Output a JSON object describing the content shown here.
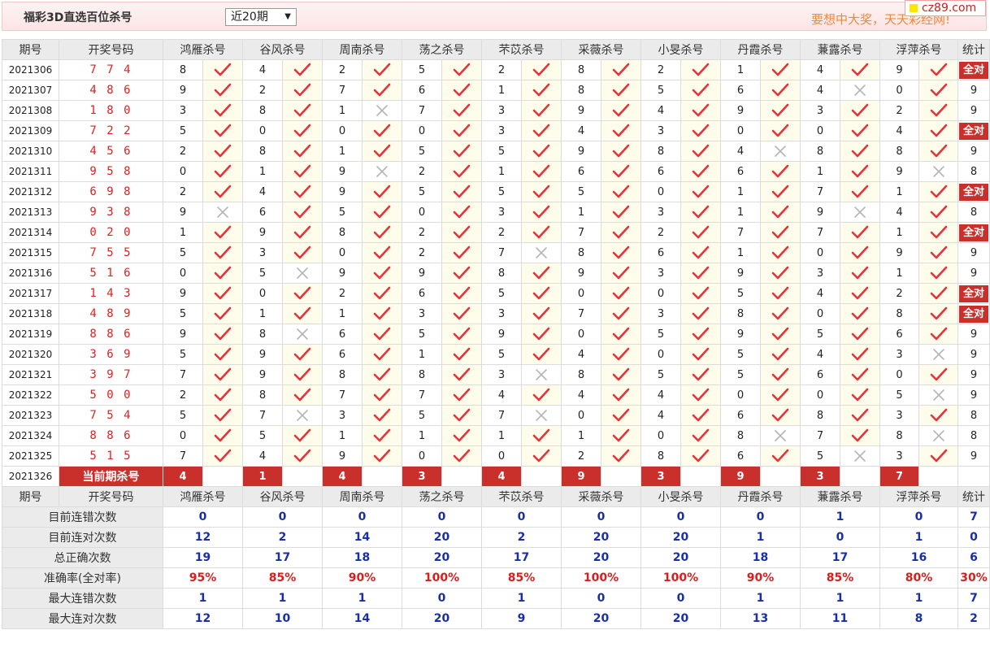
{
  "header": {
    "title": "福彩3D直选百位杀号",
    "period_select": "近20期",
    "slogan": "要想中大奖，天天彩经网!",
    "site_logo": "cz89.com"
  },
  "table": {
    "columns": {
      "period": "期号",
      "numbers": "开奖号码",
      "experts": [
        "鸿雁杀号",
        "谷风杀号",
        "周南杀号",
        "荡之杀号",
        "芣苡杀号",
        "采薇杀号",
        "小旻杀号",
        "丹霞杀号",
        "蒹露杀号",
        "浮萍杀号"
      ],
      "stat": "统计"
    },
    "rows": [
      {
        "period": "2021306",
        "numbers": "7 7 4",
        "kills": [
          "8",
          "4",
          "2",
          "5",
          "2",
          "8",
          "2",
          "1",
          "4",
          "9"
        ],
        "hits": [
          true,
          true,
          true,
          true,
          true,
          true,
          true,
          true,
          true,
          true
        ],
        "stat": "全对"
      },
      {
        "period": "2021307",
        "numbers": "4 8 6",
        "kills": [
          "9",
          "2",
          "7",
          "6",
          "1",
          "8",
          "5",
          "6",
          "4",
          "0"
        ],
        "hits": [
          true,
          true,
          true,
          true,
          true,
          true,
          true,
          true,
          false,
          true
        ],
        "stat": "9"
      },
      {
        "period": "2021308",
        "numbers": "1 8 0",
        "kills": [
          "3",
          "8",
          "1",
          "7",
          "3",
          "9",
          "4",
          "9",
          "3",
          "2"
        ],
        "hits": [
          true,
          true,
          false,
          true,
          true,
          true,
          true,
          true,
          true,
          true
        ],
        "stat": "9"
      },
      {
        "period": "2021309",
        "numbers": "7 2 2",
        "kills": [
          "5",
          "0",
          "0",
          "0",
          "3",
          "4",
          "3",
          "0",
          "0",
          "4"
        ],
        "hits": [
          true,
          true,
          true,
          true,
          true,
          true,
          true,
          true,
          true,
          true
        ],
        "stat": "全对"
      },
      {
        "period": "2021310",
        "numbers": "4 5 6",
        "kills": [
          "2",
          "8",
          "1",
          "5",
          "5",
          "9",
          "8",
          "4",
          "8",
          "8"
        ],
        "hits": [
          true,
          true,
          true,
          true,
          true,
          true,
          true,
          false,
          true,
          true
        ],
        "stat": "9"
      },
      {
        "period": "2021311",
        "numbers": "9 5 8",
        "kills": [
          "0",
          "1",
          "9",
          "2",
          "1",
          "6",
          "6",
          "6",
          "1",
          "9"
        ],
        "hits": [
          true,
          true,
          false,
          true,
          true,
          true,
          true,
          true,
          true,
          false
        ],
        "stat": "8"
      },
      {
        "period": "2021312",
        "numbers": "6 9 8",
        "kills": [
          "2",
          "4",
          "9",
          "5",
          "5",
          "5",
          "0",
          "1",
          "7",
          "1"
        ],
        "hits": [
          true,
          true,
          true,
          true,
          true,
          true,
          true,
          true,
          true,
          true
        ],
        "stat": "全对"
      },
      {
        "period": "2021313",
        "numbers": "9 3 8",
        "kills": [
          "9",
          "6",
          "5",
          "0",
          "3",
          "1",
          "3",
          "1",
          "9",
          "4"
        ],
        "hits": [
          false,
          true,
          true,
          true,
          true,
          true,
          true,
          true,
          false,
          true
        ],
        "stat": "8"
      },
      {
        "period": "2021314",
        "numbers": "0 2 0",
        "kills": [
          "1",
          "9",
          "8",
          "2",
          "2",
          "7",
          "2",
          "7",
          "7",
          "1"
        ],
        "hits": [
          true,
          true,
          true,
          true,
          true,
          true,
          true,
          true,
          true,
          true
        ],
        "stat": "全对"
      },
      {
        "period": "2021315",
        "numbers": "7 5 5",
        "kills": [
          "5",
          "3",
          "0",
          "2",
          "7",
          "8",
          "6",
          "1",
          "0",
          "9"
        ],
        "hits": [
          true,
          true,
          true,
          true,
          false,
          true,
          true,
          true,
          true,
          true
        ],
        "stat": "9"
      },
      {
        "period": "2021316",
        "numbers": "5 1 6",
        "kills": [
          "0",
          "5",
          "9",
          "9",
          "8",
          "9",
          "3",
          "9",
          "3",
          "1"
        ],
        "hits": [
          true,
          false,
          true,
          true,
          true,
          true,
          true,
          true,
          true,
          true
        ],
        "stat": "9"
      },
      {
        "period": "2021317",
        "numbers": "1 4 3",
        "kills": [
          "9",
          "0",
          "2",
          "6",
          "5",
          "0",
          "0",
          "5",
          "4",
          "2"
        ],
        "hits": [
          true,
          true,
          true,
          true,
          true,
          true,
          true,
          true,
          true,
          true
        ],
        "stat": "全对"
      },
      {
        "period": "2021318",
        "numbers": "4 8 9",
        "kills": [
          "5",
          "1",
          "1",
          "3",
          "3",
          "7",
          "3",
          "8",
          "0",
          "8"
        ],
        "hits": [
          true,
          true,
          true,
          true,
          true,
          true,
          true,
          true,
          true,
          true
        ],
        "stat": "全对"
      },
      {
        "period": "2021319",
        "numbers": "8 8 6",
        "kills": [
          "9",
          "8",
          "6",
          "5",
          "9",
          "0",
          "5",
          "9",
          "5",
          "6"
        ],
        "hits": [
          true,
          false,
          true,
          true,
          true,
          true,
          true,
          true,
          true,
          true
        ],
        "stat": "9"
      },
      {
        "period": "2021320",
        "numbers": "3 6 9",
        "kills": [
          "5",
          "9",
          "6",
          "1",
          "5",
          "4",
          "0",
          "5",
          "4",
          "3"
        ],
        "hits": [
          true,
          true,
          true,
          true,
          true,
          true,
          true,
          true,
          true,
          false
        ],
        "stat": "9"
      },
      {
        "period": "2021321",
        "numbers": "3 9 7",
        "kills": [
          "7",
          "9",
          "8",
          "8",
          "3",
          "8",
          "5",
          "5",
          "6",
          "0"
        ],
        "hits": [
          true,
          true,
          true,
          true,
          false,
          true,
          true,
          true,
          true,
          true
        ],
        "stat": "9"
      },
      {
        "period": "2021322",
        "numbers": "5 0 0",
        "kills": [
          "2",
          "8",
          "7",
          "7",
          "4",
          "4",
          "4",
          "0",
          "0",
          "5"
        ],
        "hits": [
          true,
          true,
          true,
          true,
          true,
          true,
          true,
          true,
          true,
          false
        ],
        "stat": "9"
      },
      {
        "period": "2021323",
        "numbers": "7 5 4",
        "kills": [
          "5",
          "7",
          "3",
          "5",
          "7",
          "0",
          "4",
          "6",
          "8",
          "3"
        ],
        "hits": [
          true,
          false,
          true,
          true,
          false,
          true,
          true,
          true,
          true,
          true
        ],
        "stat": "8"
      },
      {
        "period": "2021324",
        "numbers": "8 8 6",
        "kills": [
          "0",
          "5",
          "1",
          "1",
          "1",
          "1",
          "0",
          "8",
          "7",
          "8"
        ],
        "hits": [
          true,
          true,
          true,
          true,
          true,
          true,
          true,
          false,
          true,
          false
        ],
        "stat": "8"
      },
      {
        "period": "2021325",
        "numbers": "5 1 5",
        "kills": [
          "7",
          "4",
          "9",
          "0",
          "0",
          "2",
          "8",
          "6",
          "5",
          "3"
        ],
        "hits": [
          true,
          true,
          true,
          true,
          true,
          true,
          true,
          true,
          false,
          true
        ],
        "stat": "9"
      }
    ],
    "current": {
      "period": "2021326",
      "label": "当前期杀号",
      "kills": [
        "4",
        "1",
        "4",
        "3",
        "4",
        "9",
        "3",
        "9",
        "3",
        "7"
      ]
    },
    "summary": [
      {
        "label": "目前连错次数",
        "values": [
          "0",
          "0",
          "0",
          "0",
          "0",
          "0",
          "0",
          "0",
          "1",
          "0"
        ],
        "stat": "7"
      },
      {
        "label": "目前连对次数",
        "values": [
          "12",
          "2",
          "14",
          "20",
          "2",
          "20",
          "20",
          "1",
          "0",
          "1"
        ],
        "stat": "0"
      },
      {
        "label": "总正确次数",
        "values": [
          "19",
          "17",
          "18",
          "20",
          "17",
          "20",
          "20",
          "18",
          "17",
          "16"
        ],
        "stat": "6"
      },
      {
        "label": "准确率(全对率)",
        "values": [
          "95%",
          "85%",
          "90%",
          "100%",
          "85%",
          "100%",
          "100%",
          "90%",
          "85%",
          "80%"
        ],
        "stat": "30%"
      },
      {
        "label": "最大连错次数",
        "values": [
          "1",
          "1",
          "1",
          "0",
          "1",
          "0",
          "0",
          "1",
          "1",
          "1"
        ],
        "stat": "7"
      },
      {
        "label": "最大连对次数",
        "values": [
          "12",
          "10",
          "14",
          "20",
          "9",
          "20",
          "20",
          "13",
          "11",
          "8"
        ],
        "stat": "2"
      }
    ]
  },
  "icons": {
    "hit": "check-icon",
    "miss": "cross-icon"
  },
  "colors": {
    "accent_red": "#c9302c",
    "check_red": "#e8323a",
    "cross_gray": "#b5b5b5",
    "value_blue": "#1a2ea6",
    "mark_bg": "#fefcea",
    "header_bg": "#ebebeb"
  }
}
